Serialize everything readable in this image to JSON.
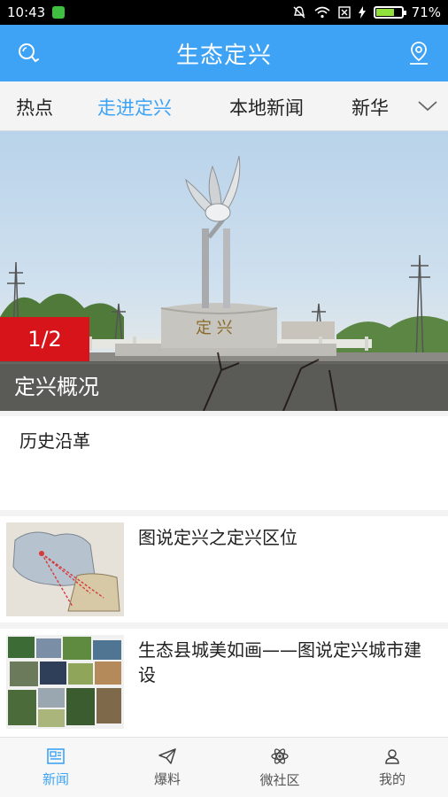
{
  "status_bar": {
    "time": "10:43",
    "battery": "71%",
    "battery_level": 0.71
  },
  "app_bar": {
    "title": "生态定兴",
    "left_icon": "search-icon",
    "right_icon": "location-pin-icon"
  },
  "tabs": [
    {
      "label": "热点",
      "active": false
    },
    {
      "label": "走进定兴",
      "active": true
    },
    {
      "label": "本地新闻",
      "active": false
    },
    {
      "label": "新华",
      "active": false
    }
  ],
  "tabs_more_icon": "chevron-down-icon",
  "banner": {
    "counter": "1/2",
    "caption": "定兴概况",
    "monument_text": "定 兴"
  },
  "cards": [
    {
      "title": "历史沿革"
    }
  ],
  "news": [
    {
      "title": "图说定兴之定兴区位"
    },
    {
      "title": "生态县城美如画——图说定兴城市建设"
    }
  ],
  "bottom_nav": [
    {
      "label": "新闻",
      "icon": "news-icon",
      "active": true
    },
    {
      "label": "爆料",
      "icon": "paper-plane-icon",
      "active": false
    },
    {
      "label": "微社区",
      "icon": "atom-icon",
      "active": false
    },
    {
      "label": "我的",
      "icon": "person-icon",
      "active": false
    }
  ],
  "colors": {
    "accent": "#3ea3f5",
    "counter_red": "#d7141a"
  }
}
